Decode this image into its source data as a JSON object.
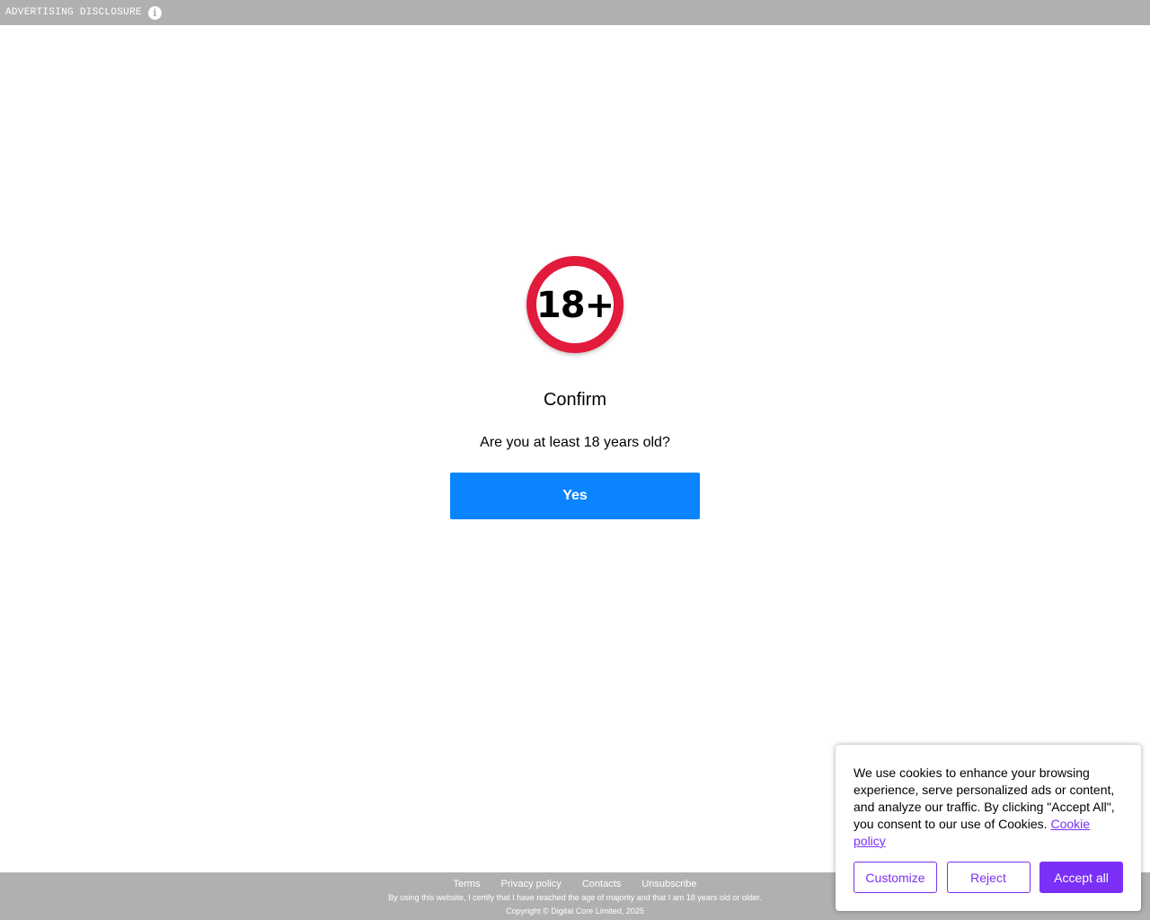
{
  "topbar": {
    "disclosure_label": "ADVERTISING DISCLOSURE",
    "info_icon": "info-icon"
  },
  "age_gate": {
    "badge_text": "18+",
    "badge_color": "#e21a3c",
    "title": "Confirm",
    "question": "Are you at least 18 years old?",
    "yes_label": "Yes",
    "yes_color": "#0a84ff"
  },
  "footer": {
    "links": [
      "Terms",
      "Privacy policy",
      "Contacts",
      "Unsubscribe"
    ],
    "certify_text": "By using this website, I certify that I have reached the age of majority and that I am 18 years old or older.",
    "copyright": "Copyright © Digital Core Limited, 2025"
  },
  "cookie": {
    "message": "We use cookies to enhance your browsing experience, serve personalized ads or content, and analyze our traffic. By clicking \"Accept All\", you consent to our use of Cookies.",
    "policy_link": "Cookie policy",
    "customize_label": "Customize",
    "reject_label": "Reject",
    "accept_label": "Accept all",
    "accent_color": "#7b2ff7"
  }
}
